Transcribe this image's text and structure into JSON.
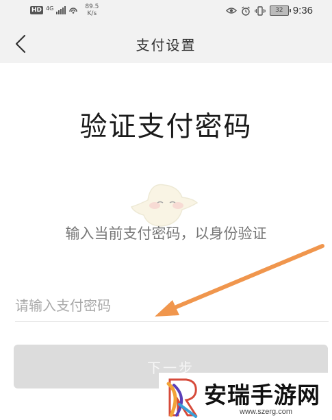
{
  "status_bar": {
    "hd_badge": "HD",
    "network_type": "4G",
    "speed_value": "89.5",
    "speed_unit": "K/s",
    "battery_level": "32",
    "time": "9:36"
  },
  "nav": {
    "title": "支付设置"
  },
  "main": {
    "title": "验证支付密码",
    "subtitle": "输入当前支付密码，以身份验证",
    "password_placeholder": "请输入支付密码",
    "password_value": "",
    "next_button_label": "下一步"
  },
  "watermark": {
    "name": "安瑞手游网",
    "url": "www.szerg.com"
  },
  "colors": {
    "annotation_arrow": "#f0964d",
    "button_disabled": "#dcdcdc",
    "status_bar_bg": "#f2f2f2"
  }
}
